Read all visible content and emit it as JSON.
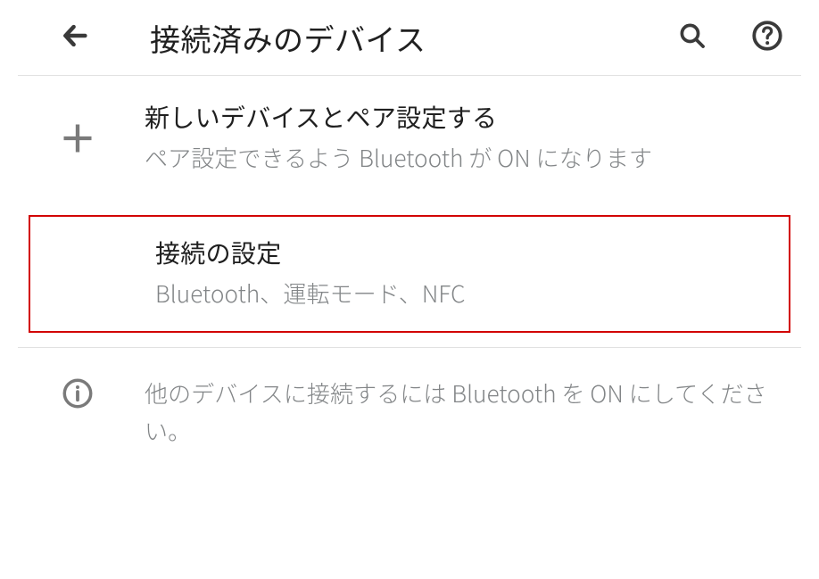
{
  "header": {
    "title": "接続済みのデバイス"
  },
  "rows": {
    "pair_new": {
      "title": "新しいデバイスとペア設定する",
      "subtitle": "ペア設定できるよう Bluetooth が ON になります"
    },
    "connection_prefs": {
      "title": "接続の設定",
      "subtitle": "Bluetooth、運転モード、NFC"
    },
    "info": {
      "text": "他のデバイスに接続するには Bluetooth を ON にしてください。"
    }
  }
}
